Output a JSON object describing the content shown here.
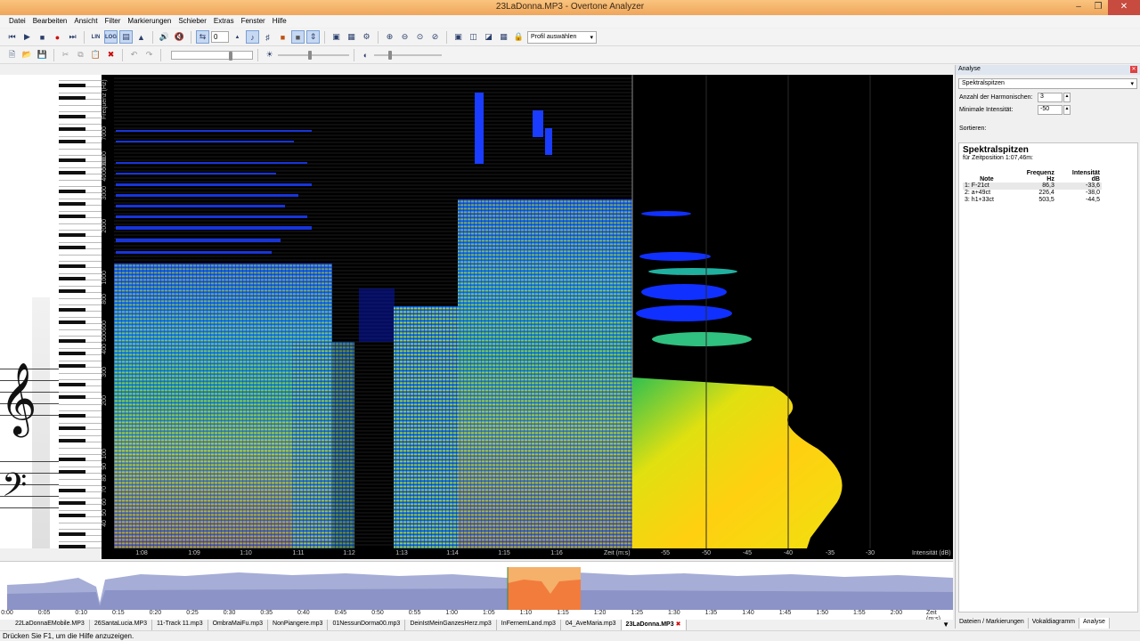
{
  "window": {
    "title": "23LaDonna.MP3 - Overtone Analyzer"
  },
  "menu": [
    "Datei",
    "Bearbeiten",
    "Ansicht",
    "Filter",
    "Markierungen",
    "Schieber",
    "Extras",
    "Fenster",
    "Hilfe"
  ],
  "toolbar": {
    "lin_label": "LIN",
    "log_label": "LOG",
    "spin_value": "0",
    "profile_select": "Profil auswählen"
  },
  "spectrogram": {
    "freq_axis_title": "Frequenz (Hz)",
    "freq_labels": [
      "7000",
      "6000",
      "5000",
      "4000",
      "3000",
      "2000",
      "1000",
      "800",
      "600",
      "500",
      "400",
      "300",
      "200",
      "100",
      "90",
      "80",
      "70",
      "60",
      "50",
      "40"
    ],
    "time_labels": [
      "1:08",
      "1:09",
      "1:10",
      "1:11",
      "1:12",
      "1:13",
      "1:14",
      "1:15",
      "1:16"
    ],
    "time_unit": "Zeit (m:s)",
    "intensity_labels": [
      "-55",
      "-50",
      "-45",
      "-40",
      "-35",
      "-30"
    ],
    "intensity_unit": "Intensität (dB)"
  },
  "overview": {
    "time_labels": [
      "0:00",
      "0:05",
      "0:10",
      "0:15",
      "0:20",
      "0:25",
      "0:30",
      "0:35",
      "0:40",
      "0:45",
      "0:50",
      "0:55",
      "1:00",
      "1:05",
      "1:10",
      "1:15",
      "1:20",
      "1:25",
      "1:30",
      "1:35",
      "1:40",
      "1:45",
      "1:50",
      "1:55",
      "2:00"
    ],
    "time_unit": "Zeit (m:s)"
  },
  "file_tabs": [
    "22LaDonnaEMobile.MP3",
    "26SantaLucia.MP3",
    "11-Track 11.mp3",
    "OmbraMaiFu.mp3",
    "NonPiangere.mp3",
    "01NessunDorma00.mp3",
    "DeinIstMeinGanzesHerz.mp3",
    "InFernemLand.mp3",
    "04_AveMaria.mp3",
    "23LaDonna.MP3"
  ],
  "status": "Drücken Sie F1, um die Hilfe anzuzeigen.",
  "panel": {
    "title": "Analyse",
    "mode": "Spektralspitzen",
    "harmonics_label": "Anzahl der Harmonischen:",
    "harmonics_value": "3",
    "min_intensity_label": "Minimale Intensität:",
    "min_intensity_value": "-50",
    "sort_label": "Sortieren:",
    "results_title": "Spektralspitzen",
    "results_subtitle": "für Zeitposition 1:07,46m:",
    "columns": {
      "note": "Note",
      "freq": "Frequenz",
      "freq_unit": "Hz",
      "intensity": "Intensität",
      "intensity_unit": "dB"
    },
    "rows": [
      {
        "idx": "1:",
        "note": "F-21ct",
        "freq": "86,3",
        "intensity": "-33,6"
      },
      {
        "idx": "2:",
        "note": "a+49ct",
        "freq": "226,4",
        "intensity": "-38,0"
      },
      {
        "idx": "3:",
        "note": "h1+33ct",
        "freq": "503,5",
        "intensity": "-44,5"
      }
    ],
    "tabs": [
      "Dateien / Markierungen",
      "Vokaldiagramm",
      "Analyse"
    ]
  }
}
